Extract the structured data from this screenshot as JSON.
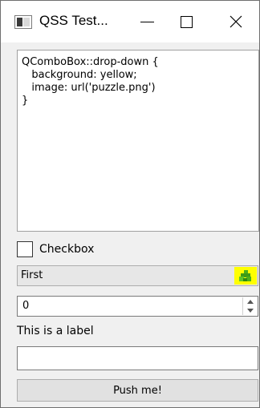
{
  "window": {
    "title": "QSS Test...",
    "minimize_icon": "minimize-icon",
    "maximize_icon": "maximize-icon",
    "close_icon": "close-icon"
  },
  "editor": {
    "text": "QComboBox::drop-down {\n   background: yellow;\n   image: url('puzzle.png')\n}"
  },
  "checkbox": {
    "label": "Checkbox",
    "checked": false
  },
  "combobox": {
    "selected": "First",
    "dropdown_icon": "puzzle-icon",
    "dropdown_bg": "#ffff00",
    "puzzle_color": "#4caf1a"
  },
  "spinbox": {
    "value": "0"
  },
  "label": {
    "text": "This is a label"
  },
  "lineedit": {
    "value": ""
  },
  "button": {
    "label": "Push me!"
  }
}
